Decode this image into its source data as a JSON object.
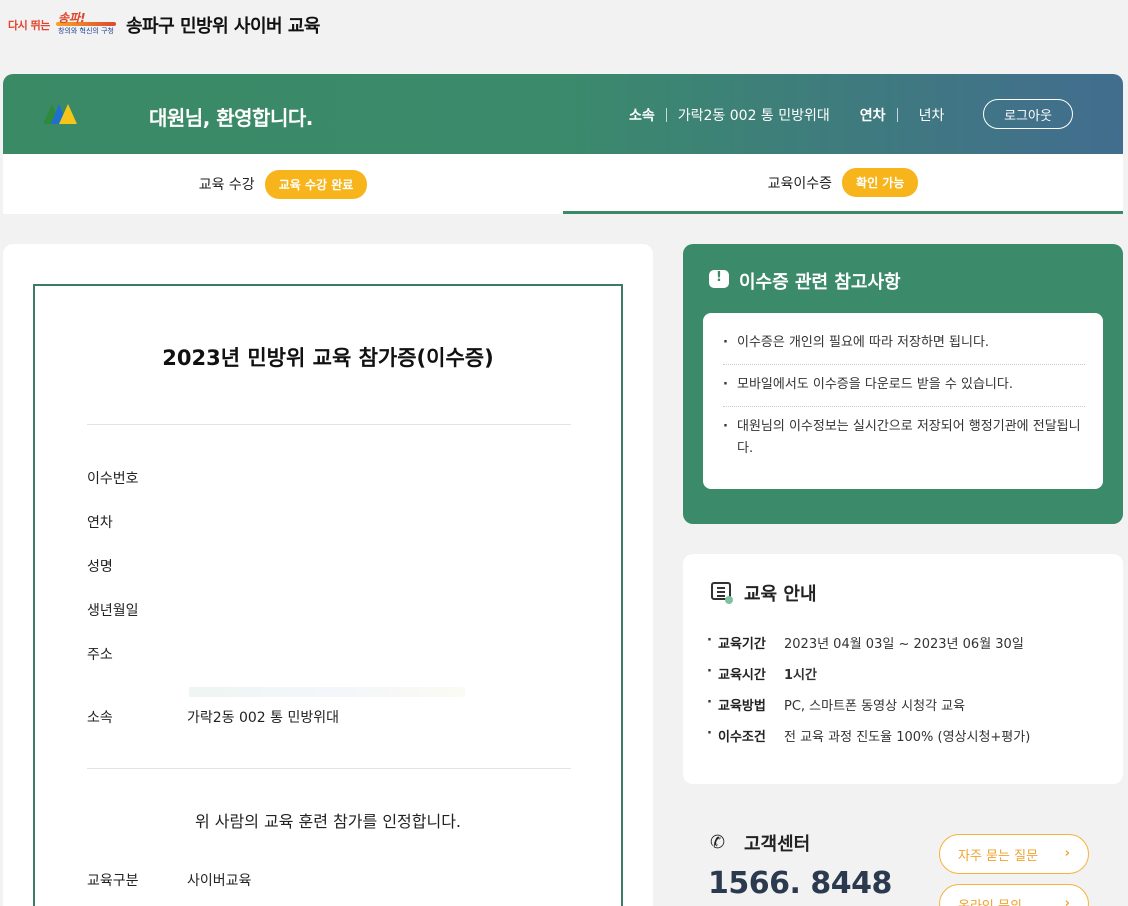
{
  "logo": {
    "line1": "다시 뛰는",
    "line2": "송파!",
    "line3": "창의와 혁신의 구청"
  },
  "site_title": "송파구 민방위 사이버 교육",
  "header": {
    "welcome": "대원님, 환영합니다.",
    "affiliation_label": "소속",
    "affiliation_value": "가락2동 002 통 민방위대",
    "year_label": "연차",
    "year_value": "년차",
    "logout": "로그아웃"
  },
  "tabs": [
    {
      "label": "교육 수강",
      "badge": "교육 수강 완료"
    },
    {
      "label": "교육이수증",
      "badge": "확인 가능"
    }
  ],
  "certificate": {
    "title": "2023년 민방위 교육 참가증(이수증)",
    "fields": [
      {
        "label": "이수번호",
        "value": ""
      },
      {
        "label": "연차",
        "value": ""
      },
      {
        "label": "성명",
        "value": ""
      },
      {
        "label": "생년월일",
        "value": ""
      },
      {
        "label": "주소",
        "value": ""
      },
      {
        "label": "소속",
        "value": "가락2동 002 통 민방위대"
      }
    ],
    "confirm_text": "위 사람의 교육 훈련 참가를 인정합니다.",
    "category_label": "교육구분",
    "category_value": "사이버교육"
  },
  "notice": {
    "title": "이수증 관련 참고사항",
    "items": [
      "이수증은 개인의 필요에 따라 저장하면 됩니다.",
      "모바일에서도 이수증을 다운로드 받을 수 있습니다.",
      "대원님의 이수정보는 실시간으로 저장되어 행정기관에 전달됩니다."
    ]
  },
  "edu_info": {
    "title": "교육 안내",
    "rows": [
      {
        "label": "교육기간",
        "value": "2023년 04월 03일 ~ 2023년 06월 30일"
      },
      {
        "label": "교육시간",
        "value": "1시간"
      },
      {
        "label": "교육방법",
        "value": "PC, 스마트폰 동영상 시청각 교육"
      },
      {
        "label": "이수조건",
        "value": "전 교육 과정 진도율 100% (영상시청+평가)"
      }
    ]
  },
  "customer_center": {
    "title": "고객센터",
    "phone": "1566. 8448",
    "faq_button": "자주 묻는 질문",
    "inquiry_button": "온라인 문의"
  },
  "colors": {
    "primary_green": "#3b8a6a",
    "accent_yellow": "#f7b51b",
    "header_blue": "#426d8f"
  }
}
